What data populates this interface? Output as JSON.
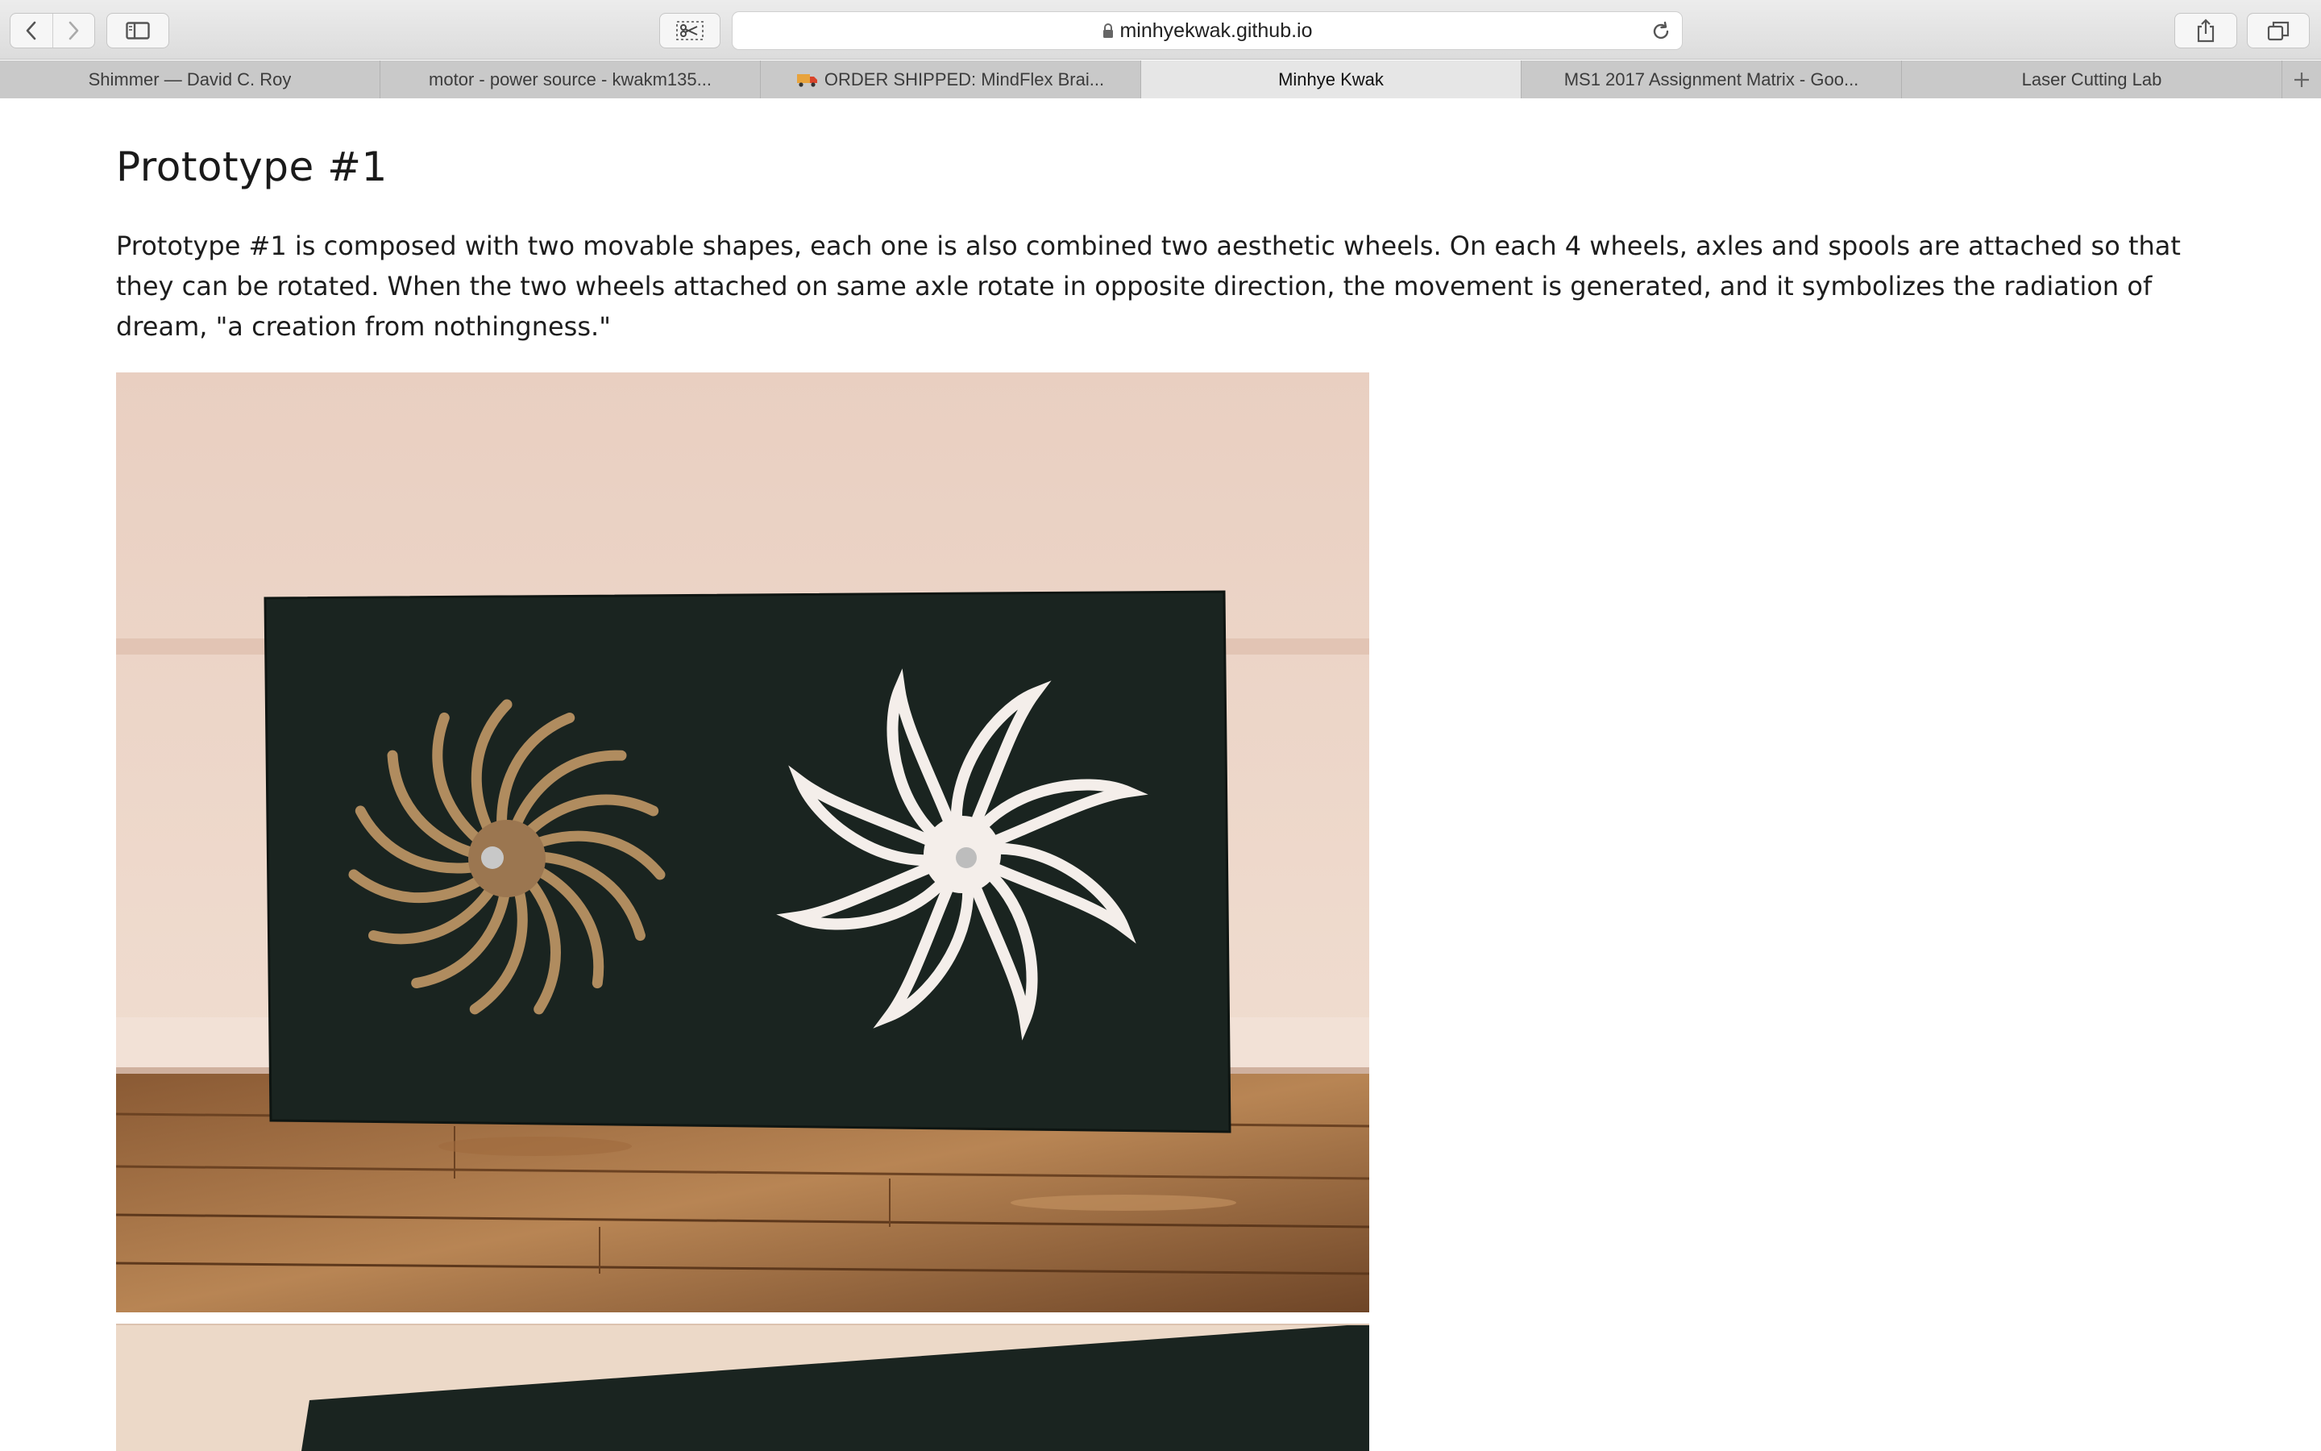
{
  "browser": {
    "url": "minhyekwak.github.io",
    "tabs": [
      {
        "label": "Shimmer — David C. Roy",
        "active": false
      },
      {
        "label": "motor - power source - kwakm135...",
        "active": false
      },
      {
        "label": "ORDER SHIPPED: MindFlex Brai...",
        "active": false,
        "icon": "truck-icon"
      },
      {
        "label": "Minhye Kwak",
        "active": true
      },
      {
        "label": "MS1 2017 Assignment Matrix - Goo...",
        "active": false
      },
      {
        "label": "Laser Cutting Lab",
        "active": false
      }
    ]
  },
  "page": {
    "title": "Prototype #1",
    "description": "Prototype #1 is composed with two movable shapes, each one is also combined two aesthetic wheels. On each 4 wheels, axles and spools are attached so that they can be rotated. When the two wheels attached on same axle rotate in opposite direction, the movement is generated, and it symbolizes the radiation of dream, \"a creation from nothingness.\""
  }
}
